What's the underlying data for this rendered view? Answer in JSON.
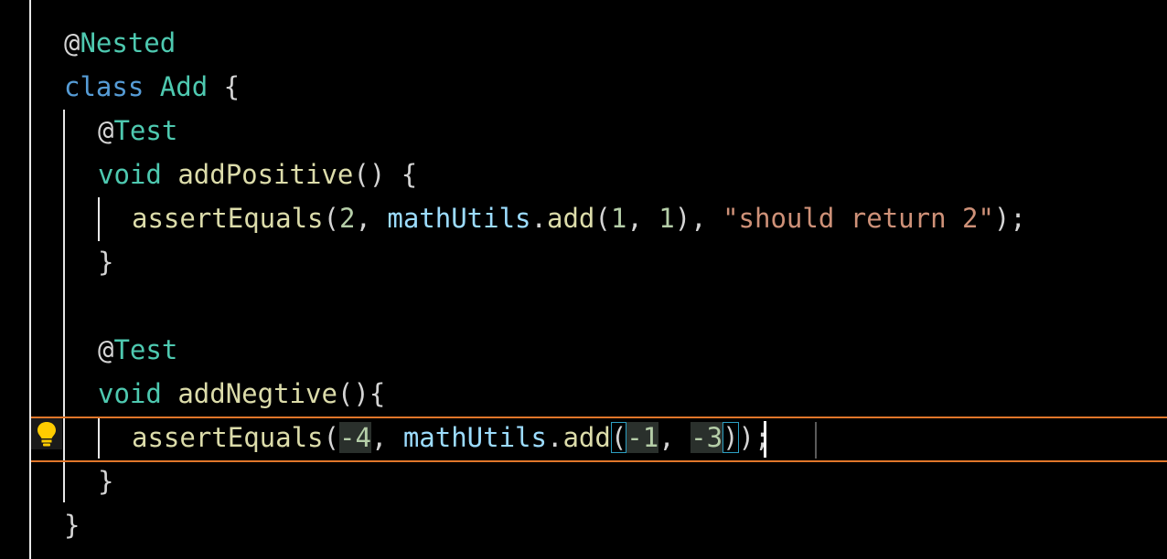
{
  "code": {
    "l1": {
      "at": "@",
      "name": "Nested"
    },
    "l2": {
      "kw": "class",
      "name": "Add",
      "brace": "{"
    },
    "l3": {
      "at": "@",
      "name": "Test"
    },
    "l4": {
      "kw": "void",
      "fn": "addPositive",
      "rest": "() {"
    },
    "l5": {
      "fn": "assertEquals",
      "p1": "(",
      "n1": "2",
      "p2": ", ",
      "obj": "mathUtils",
      "p3": ".",
      "fn2": "add",
      "p4": "(",
      "n2": "1",
      "p5": ", ",
      "n3": "1",
      "p6": "), ",
      "str": "\"should return 2\"",
      "p7": ");"
    },
    "l6": {
      "brace": "}"
    },
    "l8": {
      "at": "@",
      "name": "Test"
    },
    "l9": {
      "kw": "void",
      "fn": "addNegtive",
      "rest": "(){"
    },
    "l10": {
      "fn": "assertEquals",
      "p1": "(",
      "n1": "-4",
      "p2": ", ",
      "obj": "mathUtils",
      "p3": ".",
      "fn2": "add",
      "p4": "(",
      "n2": "-1",
      "p5": ", ",
      "n3": "-3",
      "p6": ")",
      "p7": ");"
    },
    "l11": {
      "brace": "}"
    },
    "l12": {
      "brace": "}"
    }
  },
  "icons": {
    "code_action": "lightbulb-icon"
  },
  "colors": {
    "keyword": "#569cd6",
    "type": "#4ec9b0",
    "function": "#dcdcaa",
    "variable": "#9cdcfe",
    "number": "#b5cea8",
    "string": "#ce9178",
    "current_line_border": "#e0762a",
    "lightbulb": "#ffcc00"
  }
}
